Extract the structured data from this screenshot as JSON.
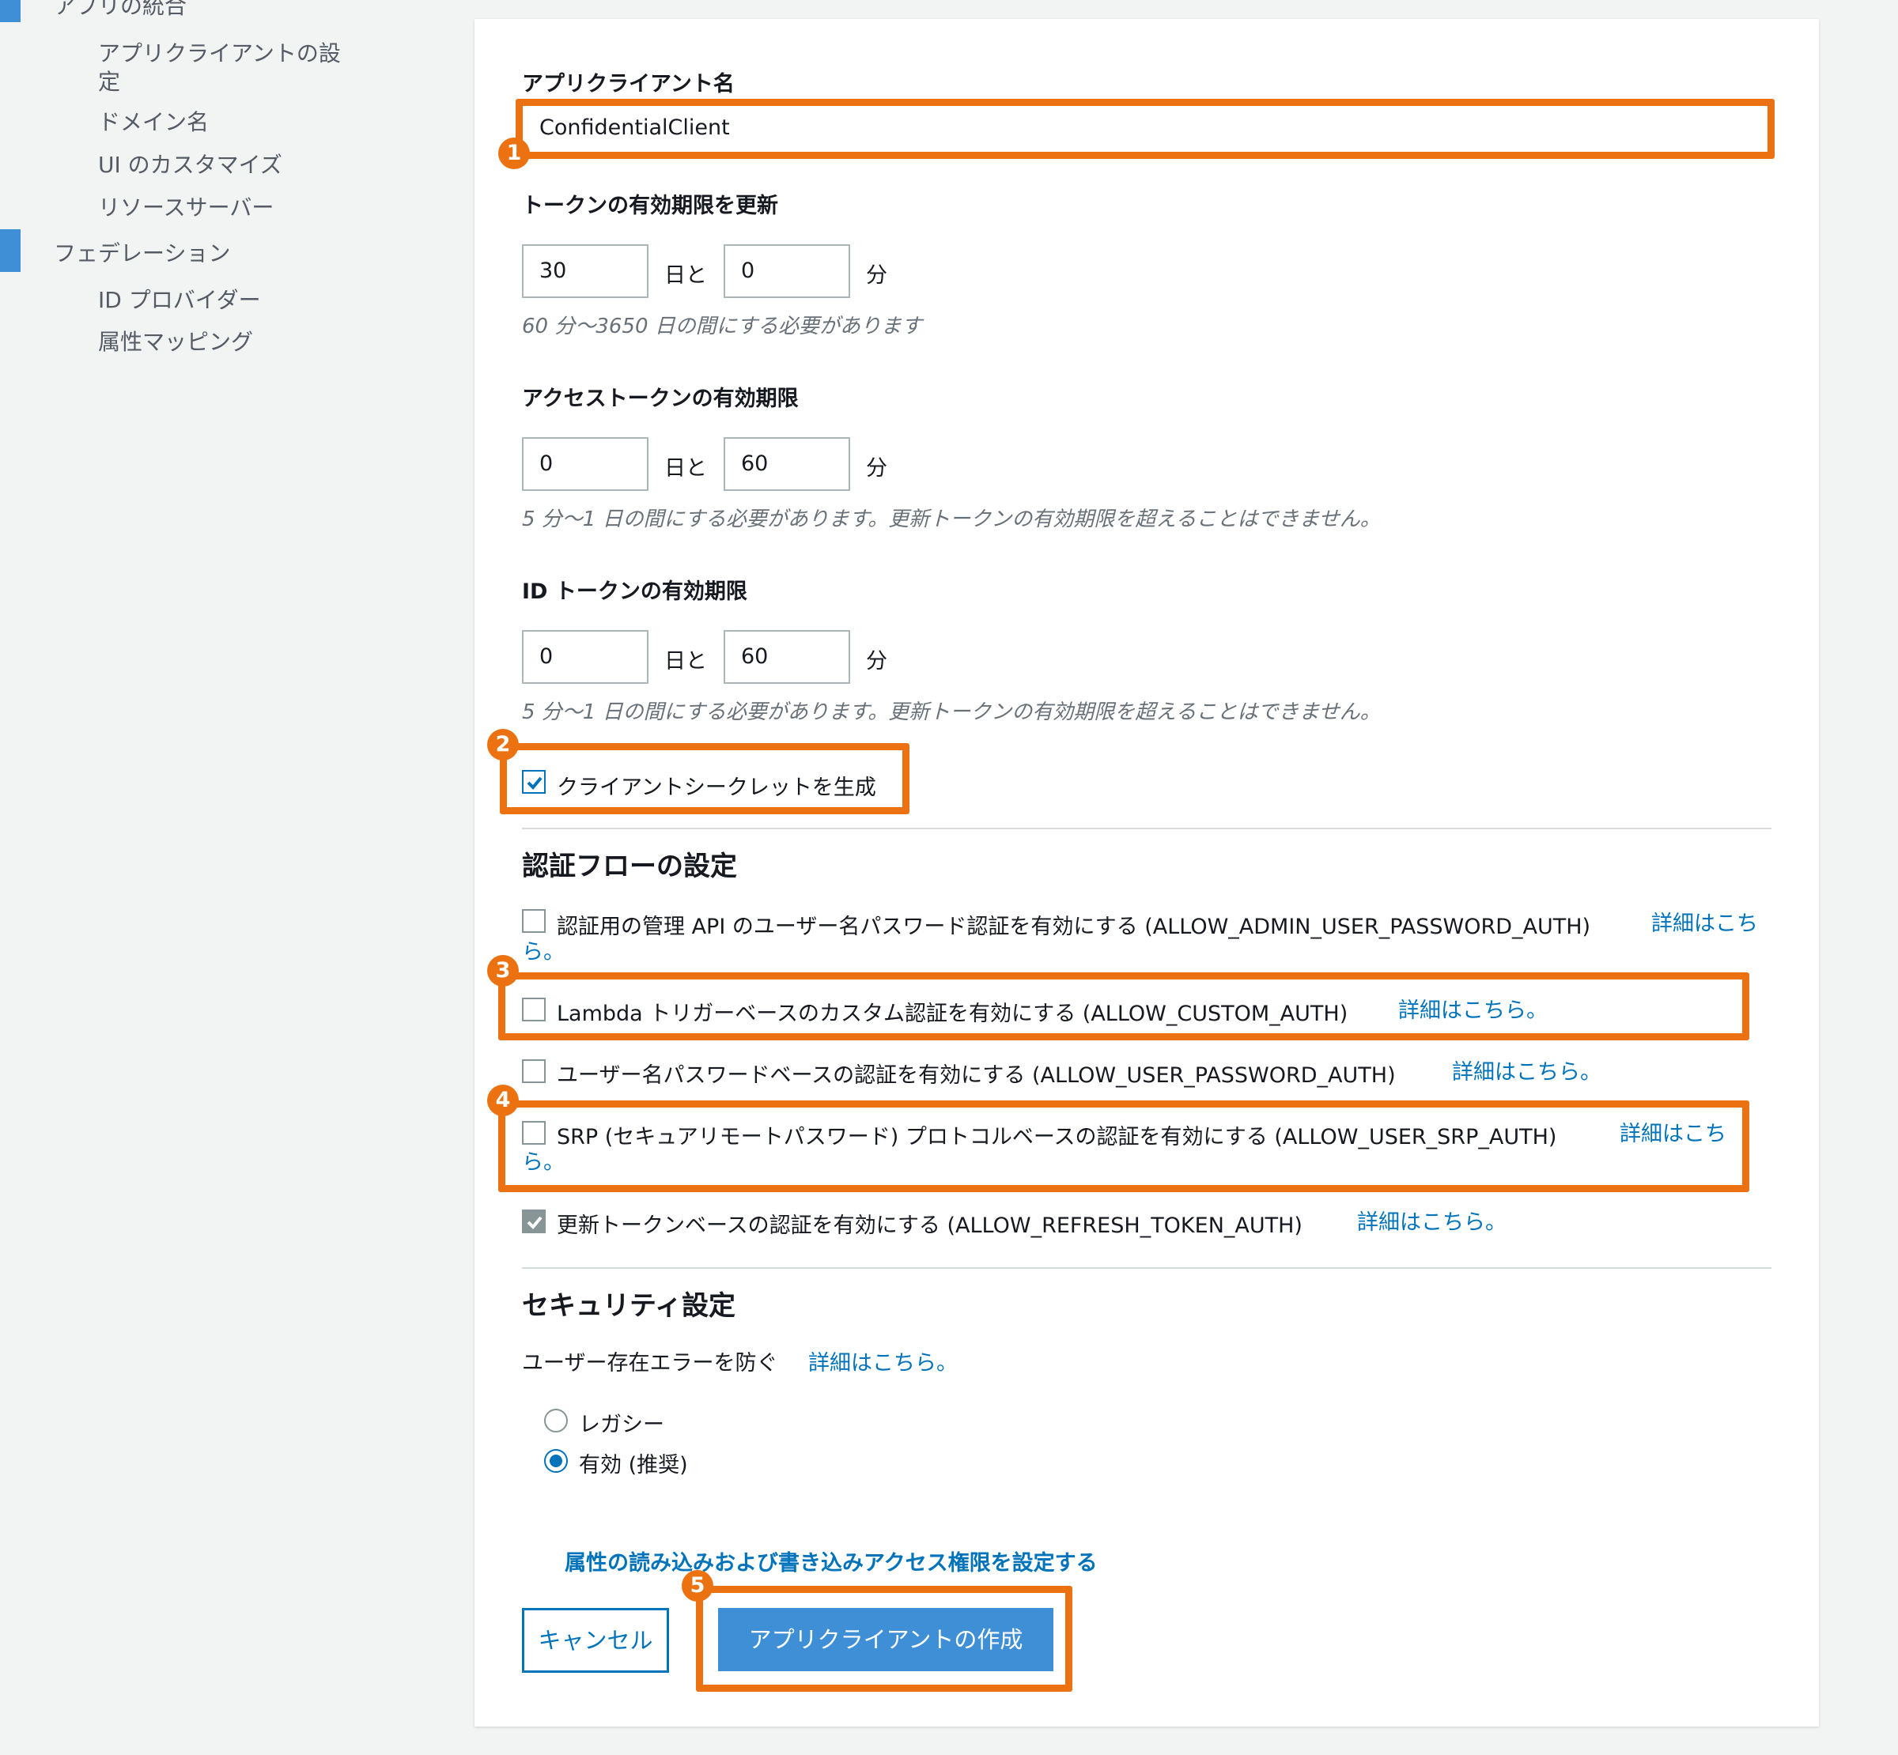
{
  "sidebar": {
    "section_app": "アプリの統合",
    "items_app": [
      "アプリクライアントの設",
      "定",
      "ドメイン名",
      "UI のカスタマイズ",
      "リソースサーバー"
    ],
    "section_federation": "フェデレーション",
    "items_federation": [
      "ID プロバイダー",
      "属性マッピング"
    ]
  },
  "form": {
    "client_name_label": "アプリクライアント名",
    "client_name_value": "ConfidentialClient",
    "refresh": {
      "label": "トークンの有効期限を更新",
      "days": "30",
      "minutes": "0",
      "days_unit": "日と",
      "minutes_unit": "分",
      "hint": "60 分〜3650 日の間にする必要があります"
    },
    "access": {
      "label": "アクセストークンの有効期限",
      "days": "0",
      "minutes": "60",
      "days_unit": "日と",
      "minutes_unit": "分",
      "hint": "5 分〜1 日の間にする必要があります。更新トークンの有効期限を超えることはできません。"
    },
    "id_token": {
      "label": "ID トークンの有効期限",
      "days": "0",
      "minutes": "60",
      "days_unit": "日と",
      "minutes_unit": "分",
      "hint": "5 分〜1 日の間にする必要があります。更新トークンの有効期限を超えることはできません。"
    },
    "generate_secret": {
      "label": "クライアントシークレットを生成",
      "checked": true
    }
  },
  "auth_flows": {
    "heading": "認証フローの設定",
    "learn_more": "詳細はこち",
    "learn_more_wrap": "ら。",
    "learn_more_full": "詳細はこちら。",
    "admin": {
      "label": "認証用の管理 API のユーザー名パスワード認証を有効にする (ALLOW_ADMIN_USER_PASSWORD_AUTH)",
      "checked": false
    },
    "custom": {
      "label": "Lambda トリガーベースのカスタム認証を有効にする (ALLOW_CUSTOM_AUTH)",
      "checked": false
    },
    "user_password": {
      "label": "ユーザー名パスワードベースの認証を有効にする (ALLOW_USER_PASSWORD_AUTH)",
      "checked": false
    },
    "srp": {
      "label": "SRP (セキュアリモートパスワード) プロトコルベースの認証を有効にする (ALLOW_USER_SRP_AUTH)",
      "checked": false
    },
    "refresh": {
      "label": "更新トークンベースの認証を有効にする (ALLOW_REFRESH_TOKEN_AUTH)",
      "checked": true
    }
  },
  "security": {
    "heading": "セキュリティ設定",
    "prevent_label": "ユーザー存在エラーを防ぐ",
    "learn_more": "詳細はこちら。",
    "options": [
      "レガシー",
      "有効 (推奨)"
    ],
    "selected": "有効 (推奨)"
  },
  "attr_link": "属性の読み込みおよび書き込みアクセス権限を設定する",
  "buttons": {
    "cancel": "キャンセル",
    "create": "アプリクライアントの作成"
  },
  "badges": [
    "1",
    "2",
    "3",
    "4",
    "5"
  ],
  "colors": {
    "highlight": "#ec7211",
    "link": "#0073bb",
    "primary_button": "#3f8fd6",
    "sidebar_accent": "#3f8fd6"
  }
}
